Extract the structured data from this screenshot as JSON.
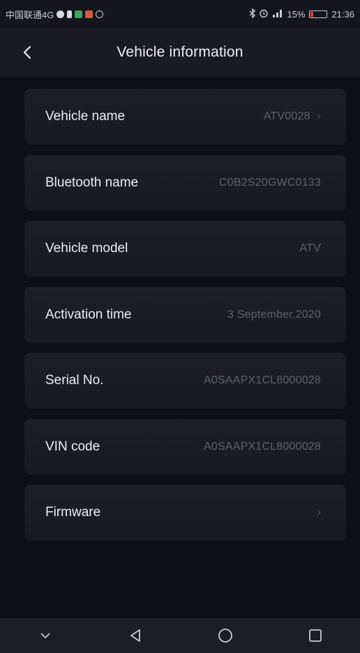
{
  "status_bar": {
    "carrier": "中国联通4G",
    "battery_percent": "15%",
    "battery_level": 0.15,
    "time": "21:36",
    "left_icons": [
      "app-icon",
      "sim-icon",
      "message-icon",
      "email-icon",
      "sync-icon"
    ],
    "right_icons": [
      "bluetooth-icon",
      "alarm-icon",
      "signal-icon"
    ]
  },
  "header": {
    "title": "Vehicle information",
    "back_icon": "chevron-left-icon"
  },
  "items": [
    {
      "label": "Vehicle name",
      "value": "ATV0028",
      "chevron": true
    },
    {
      "label": "Bluetooth name",
      "value": "C0B2S20GWC0133",
      "chevron": false
    },
    {
      "label": "Vehicle model",
      "value": "ATV",
      "chevron": false
    },
    {
      "label": "Activation time",
      "value": "3 September,2020",
      "chevron": false
    },
    {
      "label": "Serial No.",
      "value": "A0SAAPX1CL8000028",
      "chevron": false
    },
    {
      "label": "VIN code",
      "value": "A0SAAPX1CL8000028",
      "chevron": false
    },
    {
      "label": "Firmware",
      "value": "",
      "chevron": true
    }
  ],
  "chevron_glyph": "›",
  "nav_bar": {
    "buttons": [
      "chevron-down-icon",
      "back-triangle-icon",
      "home-circle-icon",
      "recents-square-icon"
    ]
  },
  "colors": {
    "background": "#0e0f16",
    "card": "#1c1d26",
    "label": "#eceef4",
    "value": "#5d6170",
    "battery_low": "#e23a3a"
  }
}
